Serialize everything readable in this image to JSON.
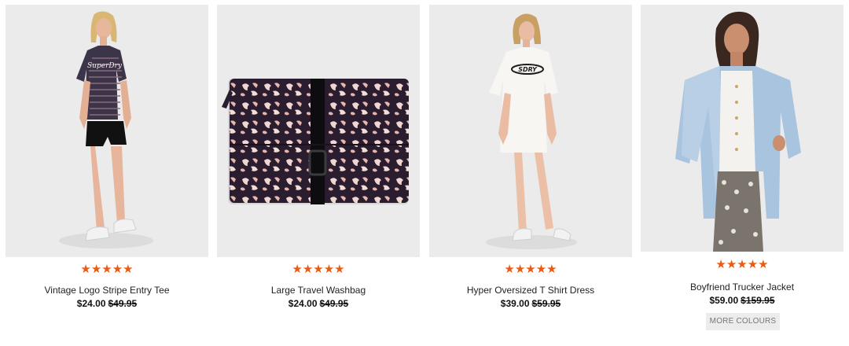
{
  "products": [
    {
      "name": "Vintage Logo Stripe Entry Tee",
      "stars": "★★★★★",
      "price": "$24.00",
      "old_price": "$49.95",
      "shirt_logo": "SuperDry"
    },
    {
      "name": "Large Travel Washbag",
      "stars": "★★★★★",
      "price": "$24.00",
      "old_price": "$49.95"
    },
    {
      "name": "Hyper Oversized T Shirt Dress",
      "stars": "★★★★★",
      "price": "$39.00",
      "old_price": "$59.95",
      "shirt_logo": "SDRY"
    },
    {
      "name": "Boyfriend Trucker Jacket",
      "stars": "★★★★★",
      "price": "$59.00",
      "old_price": "$159.95",
      "more_colours": "MORE COLOURS"
    }
  ],
  "colors": {
    "star": "#ea5a12",
    "image_bg": "#ebebeb"
  }
}
